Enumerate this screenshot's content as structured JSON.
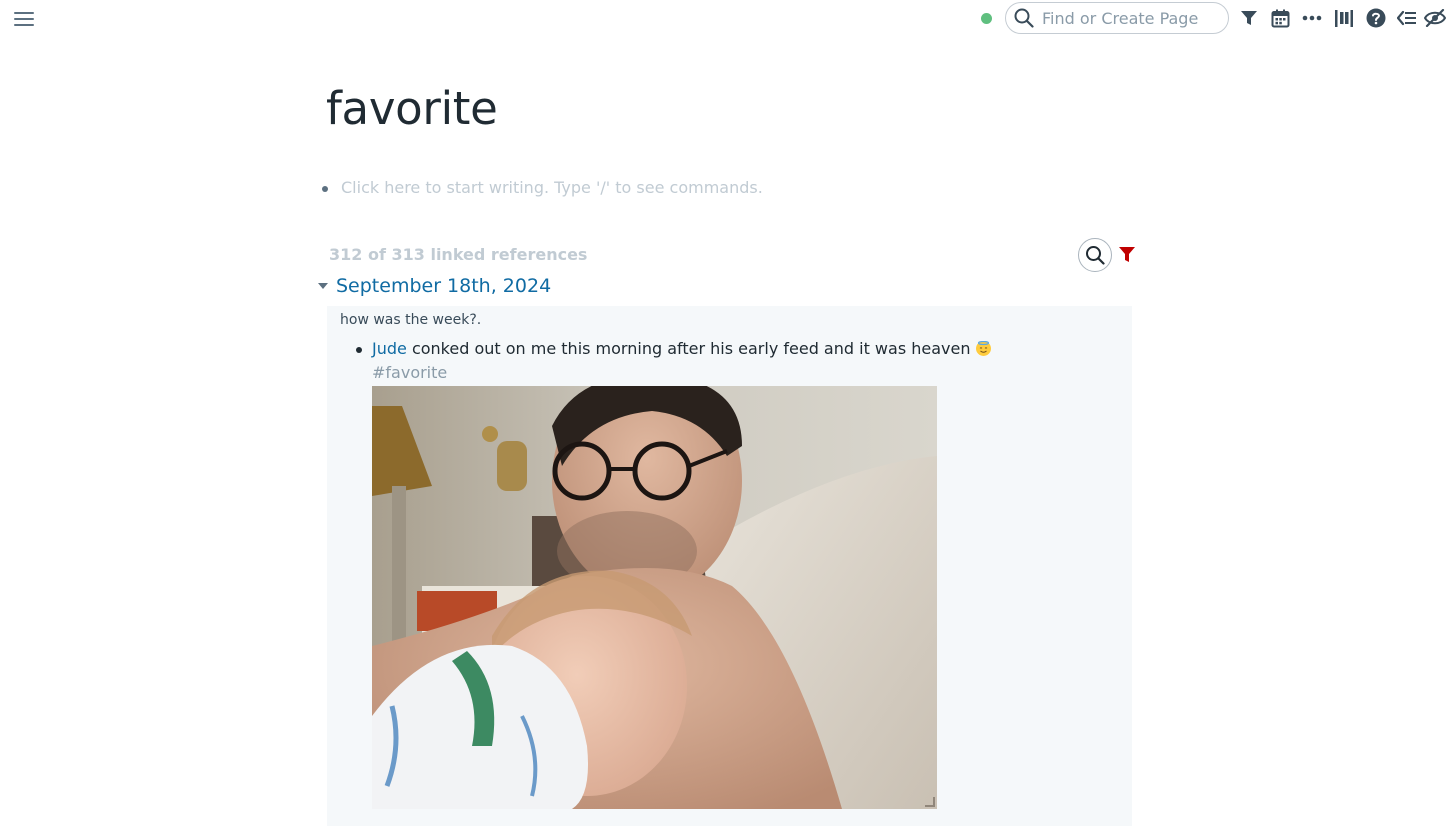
{
  "topbar": {
    "search_placeholder": "Find or Create Page",
    "icons": [
      "menu-icon",
      "sync-status-icon",
      "search-icon",
      "filter-icon",
      "daily-notes-calendar-icon",
      "more-icon",
      "all-pages-icon",
      "help-icon",
      "sidebar-outline-icon",
      "hide-icon"
    ],
    "status_color": "#5fbf7f"
  },
  "page": {
    "title": "favorite",
    "empty_block_hint": "Click here to start writing. Type '/' to see commands."
  },
  "linked_refs": {
    "count_label": "312 of 313 linked references",
    "filter_color": "#c00000",
    "groups": [
      {
        "date": "September 18th, 2024",
        "breadcrumb": "how was the week?.",
        "block": {
          "link": "Jude",
          "text": " conked out on me this morning after his early feed and it was heaven ",
          "tag": "#favorite",
          "emoji": "smiling-face-with-halo"
        }
      }
    ]
  },
  "colors": {
    "link": "#106ba3",
    "muted": "#c1cbd3",
    "card_bg": "#f5f8fa"
  }
}
